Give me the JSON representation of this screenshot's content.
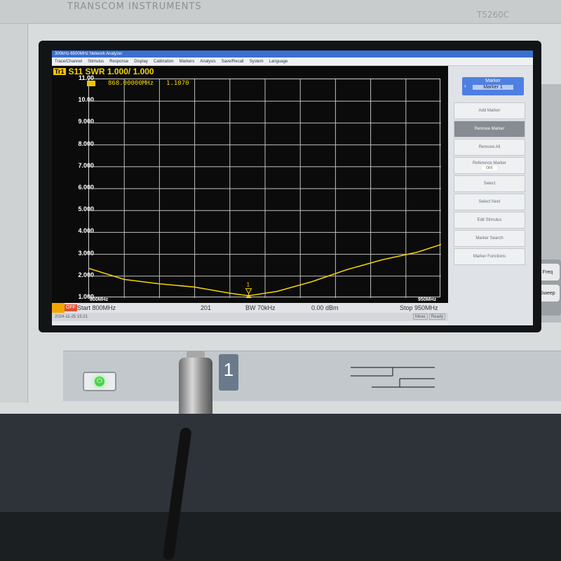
{
  "instrument": {
    "brand": "TRANSCOM INSTRUMENTS",
    "model": "T5260C"
  },
  "window": {
    "title": "300kHz-6500MHz Network Analyzer"
  },
  "menu": [
    "Trace/Channel",
    "Stimulus",
    "Response",
    "Display",
    "Calibration",
    "Markers",
    "Analysis",
    "Save/Recall",
    "System",
    "Language"
  ],
  "trace": {
    "badge": "Tr1",
    "label": "S11 SWR 1.000/ 1.000"
  },
  "marker_readout": {
    "frequency": "868.00000MHz",
    "value": "1.1070"
  },
  "status": {
    "off_label": "OFF",
    "start": "Start 800MHz",
    "points": "201",
    "bw": "BW 70kHz",
    "power": "0.00 dBm",
    "stop": "Stop 950MHz"
  },
  "footer": {
    "timestamp": "2024-11-25 15:21",
    "meas": "Meas",
    "ready": "Ready"
  },
  "softkeys": {
    "title": "Marker",
    "subtitle": "Marker 1",
    "back_icon": "chevron-left-icon",
    "items": [
      {
        "label": "Add Marker",
        "active": false
      },
      {
        "label": "Remove Marker",
        "active": true
      },
      {
        "label": "Remove All",
        "active": false
      },
      {
        "label": "Reference Marker",
        "value": "OFF",
        "active": false
      },
      {
        "label": "Select",
        "active": false
      },
      {
        "label": "Select Next",
        "active": false
      },
      {
        "label": "Edit Stimulus",
        "active": false
      },
      {
        "label": "Marker Search",
        "active": false
      },
      {
        "label": "Marker Functions",
        "active": false
      }
    ]
  },
  "right_panel": {
    "freq": "Freq",
    "sweep": "Sweep"
  },
  "front": {
    "port": "1",
    "power_icon": "power-icon"
  },
  "colors": {
    "trace": "#f5d400",
    "grid_bg": "#0b0b0b",
    "titlebar": "#3a6fd0",
    "softkey_active": "#878c93"
  },
  "chart_data": {
    "type": "line",
    "title": "S11 SWR 1.000/ 1.000",
    "xlabel": "",
    "ylabel": "",
    "x_tick_labels": [
      "800MHz",
      "950MHz"
    ],
    "y_tick_labels": [
      "11.00",
      "10.00",
      "9.000",
      "8.000",
      "7.000",
      "6.000",
      "5.000",
      "4.000",
      "3.000",
      "2.000",
      "1.000"
    ],
    "xlim": [
      800,
      950
    ],
    "ylim": [
      1,
      11
    ],
    "grid": true,
    "x": [
      800,
      815,
      830,
      845,
      860,
      868,
      880,
      895,
      910,
      925,
      940,
      950
    ],
    "series": [
      {
        "values": [
          2.35,
          1.85,
          1.65,
          1.5,
          1.22,
          1.107,
          1.3,
          1.75,
          2.3,
          2.75,
          3.1,
          3.45
        ]
      }
    ],
    "markers": [
      {
        "label": "1",
        "x": 868,
        "y": 1.107
      }
    ]
  }
}
